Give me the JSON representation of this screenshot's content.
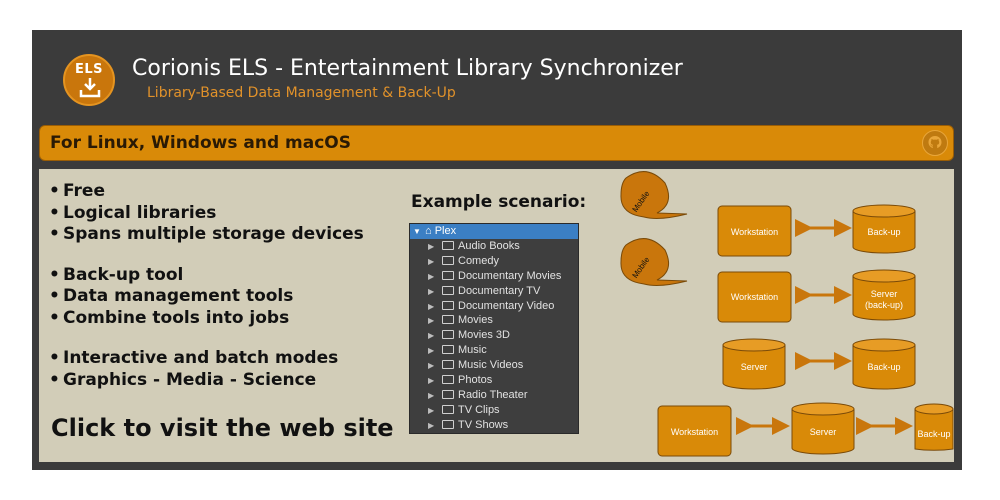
{
  "header": {
    "logo_text": "ELS",
    "title": "Corionis ELS - Entertainment Library Synchronizer",
    "subtitle": "Library-Based Data Management & Back-Up"
  },
  "banner": {
    "text": "For Linux, Windows and macOS",
    "github_icon": "github-icon"
  },
  "features": {
    "group1": [
      "Free",
      "Logical libraries",
      "Spans multiple storage devices"
    ],
    "group2": [
      "Back-up tool",
      "Data management tools",
      "Combine tools into jobs"
    ],
    "group3": [
      "Interactive and batch modes",
      "Graphics - Media - Science"
    ]
  },
  "visit_text": "Click to visit the web site",
  "scenario": {
    "title": "Example scenario:",
    "root": "Plex",
    "items": [
      "Audio Books",
      "Comedy",
      "Documentary Movies",
      "Documentary TV",
      "Documentary Video",
      "Movies",
      "Movies 3D",
      "Music",
      "Music Videos",
      "Photos",
      "Radio Theater",
      "TV Clips",
      "TV Shows"
    ]
  },
  "diagram": {
    "mobile": "Mobile",
    "workstation": "Workstation",
    "backup": "Back-up",
    "server": "Server",
    "server_backup_1": "Server",
    "server_backup_2": "(back-up)"
  },
  "colors": {
    "accent": "#d98a08",
    "background": "#3b3b3b",
    "panel": "#d2cdb8",
    "tree_selected": "#3b7fc4"
  }
}
